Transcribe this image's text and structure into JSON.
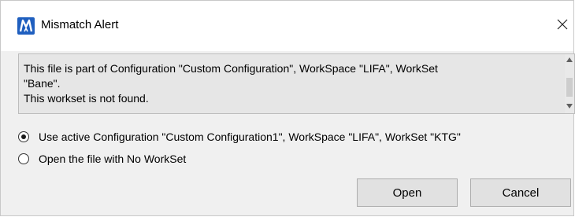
{
  "window": {
    "title": "Mismatch Alert",
    "close_glyph": "✕",
    "app_icon": "microstation-icon",
    "accent": "#1f5fbf"
  },
  "message": {
    "lines": [
      "This file is part of Configuration \"Custom Configuration\", WorkSpace \"LIFA\", WorkSet",
      "\"Bane\".",
      "This workset is not found."
    ]
  },
  "options": [
    {
      "label": "Use active Configuration \"Custom Configuration1\", WorkSpace \"LIFA\", WorkSet \"KTG\"",
      "selected": true
    },
    {
      "label": "Open the file with No WorkSet",
      "selected": false
    }
  ],
  "buttons": {
    "open_label": "Open",
    "cancel_label": "Cancel"
  }
}
